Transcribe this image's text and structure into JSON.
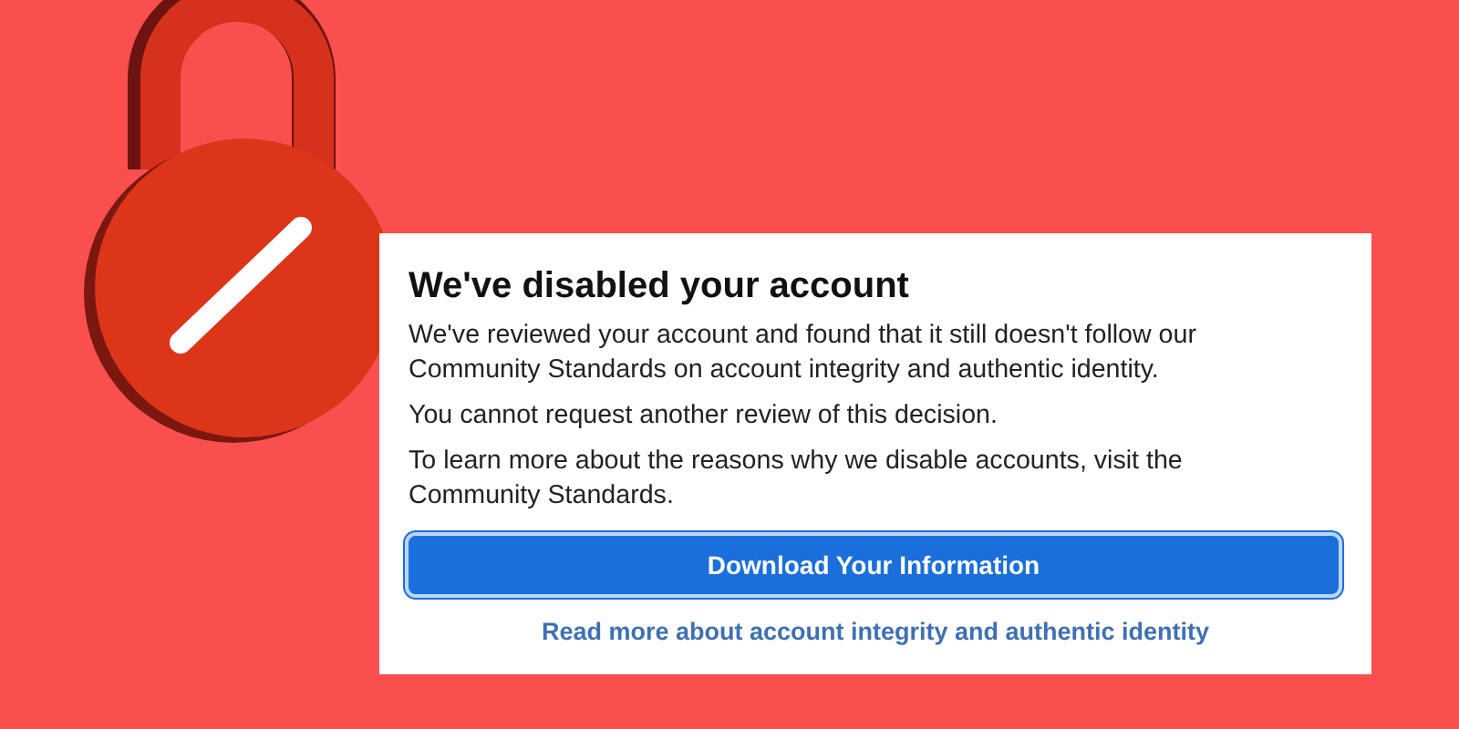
{
  "dialog": {
    "title": "We've disabled your account",
    "paragraphs": [
      "We've reviewed your account and found that it still doesn't follow our Community Standards on account integrity and authentic identity.",
      "You cannot request another review of this decision.",
      "To learn more about the reasons why we disable accounts, visit the Community Standards."
    ],
    "button": "Download Your Information",
    "link": "Read more about account integrity and authentic identity"
  }
}
